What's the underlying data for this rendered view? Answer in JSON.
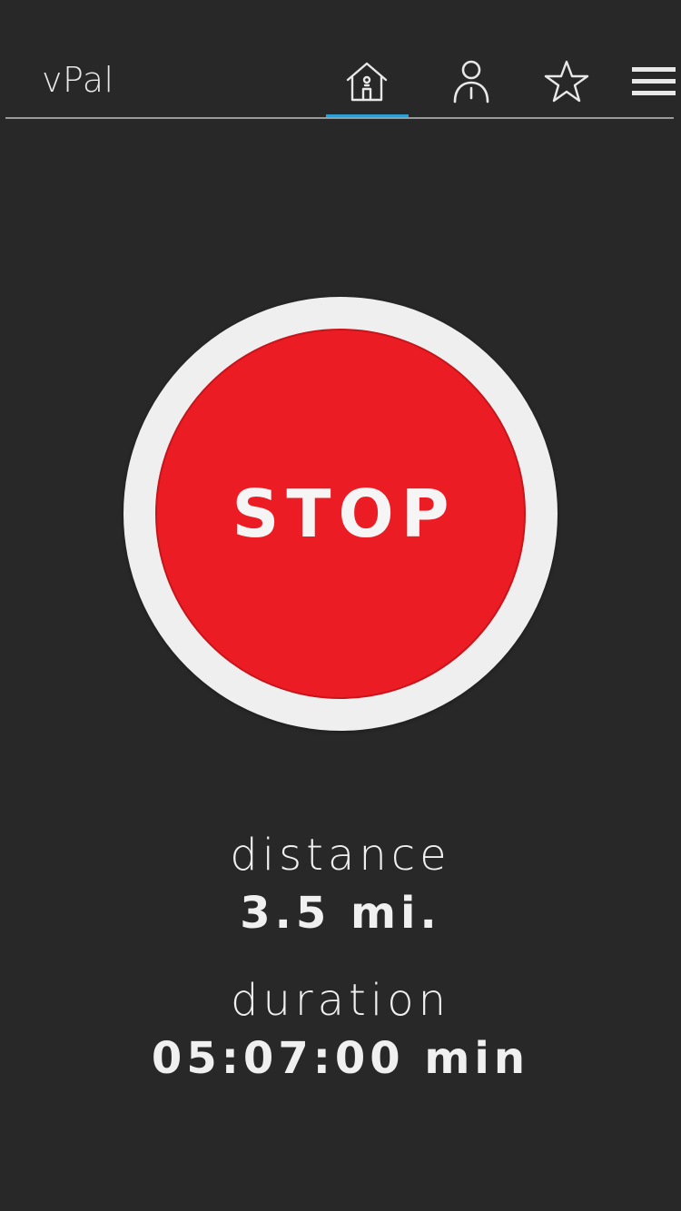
{
  "header": {
    "app_title": "vPal",
    "nav": [
      {
        "icon": "home-icon",
        "active": true
      },
      {
        "icon": "user-icon",
        "active": false
      },
      {
        "icon": "star-icon",
        "active": false
      },
      {
        "icon": "menu-icon",
        "active": false
      }
    ],
    "accent_color": "#2e9fd6"
  },
  "main": {
    "stop_button_label": "STOP",
    "stop_color": "#ec1c24"
  },
  "stats": {
    "distance_label": "distance",
    "distance_value": "3.5 mi.",
    "duration_label": "duration",
    "duration_value": "05:07:00 min"
  }
}
